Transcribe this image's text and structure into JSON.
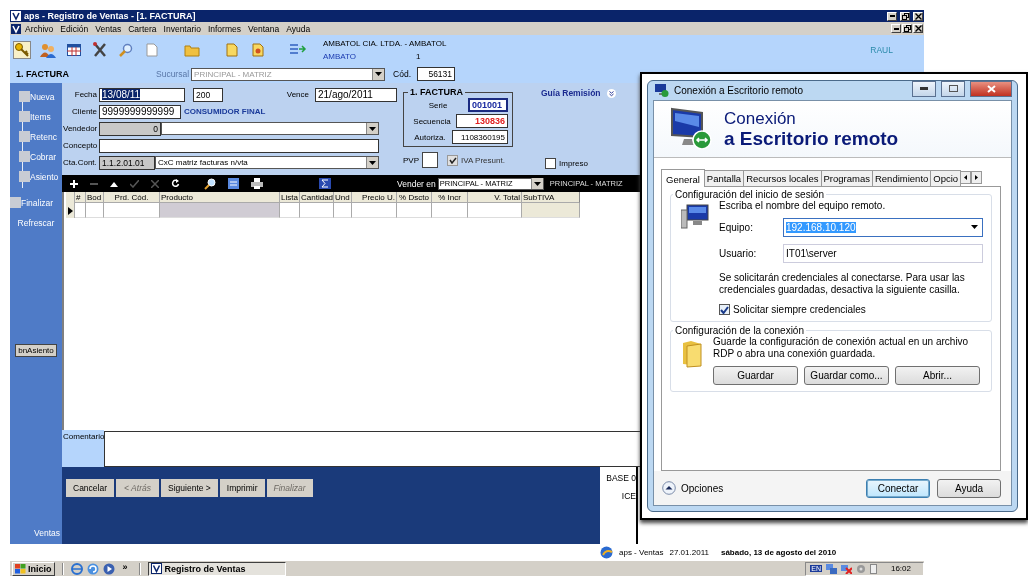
{
  "window": {
    "title": "aps - Registro de Ventas - [1. FACTURA]"
  },
  "menu": [
    "Archivo",
    "Edición",
    "Ventas",
    "Cartera",
    "Inventario",
    "Informes",
    "Ventana",
    "Ayuda"
  ],
  "toolbar": {
    "company": "AMBATOL CIA. LTDA. - AMBATOL",
    "city": "AMBATO",
    "city_code": "1",
    "user": "RAUL"
  },
  "header": {
    "title": "1. FACTURA",
    "sucursal_label": "Sucursal",
    "sucursal": "PRINCIPAL - MATRIZ",
    "cod_label": "Cód.",
    "cod": "56131"
  },
  "sidebar": {
    "items": [
      "Nueva",
      "Items",
      "Retenc",
      "Cobrar",
      "Asiento",
      "Finalizar"
    ],
    "refresh": "Refrescar",
    "asiento_button": "bnAsiento",
    "footer": "Ventas"
  },
  "form": {
    "fecha": {
      "label": "Fecha",
      "value": "13/08/11",
      "highlighted": true
    },
    "dias": "200",
    "vence": {
      "label": "Vence",
      "value": "21/ago/2011"
    },
    "cliente": {
      "label": "Cliente",
      "value": "9999999999999",
      "name": "CONSUMIDOR FINAL"
    },
    "vendedor": {
      "label": "Vendedor",
      "code": "0"
    },
    "concepto": {
      "label": "Concepto"
    },
    "cuenta": {
      "label": "Cta.Cont.",
      "code": "1.1.2.01.01",
      "name": "CxC matriz facturas n/vta"
    },
    "factura": {
      "title": "1. FACTURA",
      "serie_label": "Serie",
      "serie": "001001",
      "secuencia_label": "Secuencia",
      "secuencia": "130836",
      "autoriza_label": "Autoriza.",
      "autoriza": "1108360195"
    },
    "guia": "Guía Remisión",
    "pvp": {
      "label": "PVP",
      "checked": false
    },
    "iva": {
      "label": "IVA Presunt.",
      "checked": true,
      "disabled": true
    },
    "impreso": {
      "label": "Impreso",
      "checked": false
    }
  },
  "grid": {
    "vender_label": "Vender en",
    "vender": "PRINCIPAL - MATRIZ",
    "vender_note": "PRINCIPAL - MATRIZ",
    "columns": [
      "#",
      "Bod",
      "Prd. Cód.",
      "Producto",
      "Lista",
      "Cantidad",
      "Und",
      "Precio U.",
      "% Dscto",
      "% Incr",
      "V. Total",
      "SubTIVA"
    ]
  },
  "comment": {
    "label": "Comentario"
  },
  "wizard": [
    {
      "label": "Cancelar",
      "disabled": false
    },
    {
      "label": "< Atrás",
      "disabled": true
    },
    {
      "label": "Siguiente >",
      "disabled": false
    },
    {
      "label": "Imprimir",
      "disabled": false
    },
    {
      "label": "Finalizar",
      "disabled": true
    }
  ],
  "totals": [
    "BASE 0",
    "ICE"
  ],
  "status": {
    "app": "aps - Ventas",
    "date": "27.01.2011",
    "long_date": "sábado, 13 de agosto del 2010"
  },
  "taskbar": {
    "start": "Inicio",
    "more": "»",
    "tasks": [
      {
        "label": "Registro de Ventas",
        "selected": true
      }
    ],
    "language": "EN",
    "clock": "16:02"
  },
  "dialog": {
    "title": "Conexión a Escritorio remoto",
    "heading": "Conexión",
    "subheading": "a Escritorio remoto",
    "tabs": [
      {
        "label": "General",
        "selected": true
      },
      {
        "label": "Pantalla",
        "selected": false
      },
      {
        "label": "Recursos locales",
        "selected": false
      },
      {
        "label": "Programas",
        "selected": false
      },
      {
        "label": "Rendimiento",
        "selected": false
      },
      {
        "label": "Opcio",
        "selected": false
      }
    ],
    "login": {
      "legend": "Configuración del inicio de sesión",
      "intro": "Escriba el nombre del equipo remoto.",
      "equipo_label": "Equipo:",
      "equipo": "192.168.10.120",
      "equipo_highlighted": true,
      "usuario_label": "Usuario:",
      "usuario": "IT01\\server",
      "note": "Se solicitarán credenciales al conectarse. Para usar las credenciales guardadas, desactiva la siguiente casilla.",
      "ask": {
        "label": "Solicitar siempre credenciales",
        "checked": true
      }
    },
    "connection": {
      "legend": "Configuración de la conexión",
      "text": "Guarde la configuración de conexión actual en un archivo RDP o abra una conexión guardada.",
      "buttons": [
        "Guardar",
        "Guardar como...",
        "Abrir..."
      ]
    },
    "options": "Opciones",
    "buttons": [
      {
        "label": "Conectar",
        "default": true
      },
      {
        "label": "Ayuda",
        "default": false
      }
    ]
  }
}
